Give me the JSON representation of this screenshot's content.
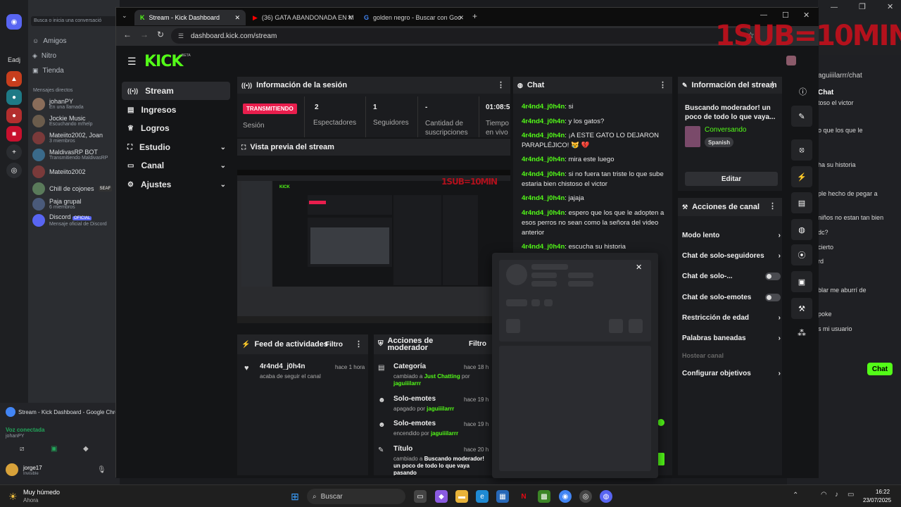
{
  "overlay_text": "1SUB=10MIN",
  "discord": {
    "search_placeholder": "Busca o inicia una conversació",
    "nav": [
      "Amigos",
      "Nitro",
      "Tienda"
    ],
    "dm_header": "Mensajes directos",
    "server_label": "Eadj",
    "dms": [
      {
        "name": "johanPY",
        "sub": "En una llamada"
      },
      {
        "name": "Jockie Music",
        "sub": "Escuchando m!help"
      },
      {
        "name": "Mateiito2002, Joan",
        "sub": "3 miembros"
      },
      {
        "name": "MaldivasRP BOT",
        "sub": "Transmitiendo MaldivasRP"
      },
      {
        "name": "Mateiito2002",
        "sub": ""
      },
      {
        "name": "Chill de cojones",
        "sub": "",
        "badge": "SEAF"
      },
      {
        "name": "Paja grupal",
        "sub": "6 miembros"
      },
      {
        "name": "Discord",
        "sub": "Mensaje oficial de Discord",
        "badge": "OFICIAL"
      }
    ],
    "stream_card": "Stream - Kick Dashboard - Google Chrome",
    "voice": "Voz conectada",
    "voice_user": "johanPY",
    "user": "jorge17",
    "user_status": "Invisible"
  },
  "chrome": {
    "tabs": [
      {
        "title": "Stream - Kick Dashboard",
        "active": true
      },
      {
        "title": "(36) GATA ABANDONADA EN M",
        "active": false
      },
      {
        "title": "golden negro - Buscar con Goo",
        "active": false
      }
    ],
    "url": "dashboard.kick.com/stream"
  },
  "kick": {
    "logo": "KICK",
    "beta": "BETA",
    "sidebar": [
      {
        "label": "Stream",
        "icon": "broadcast-icon",
        "active": true
      },
      {
        "label": "Ingresos",
        "icon": "wallet-icon"
      },
      {
        "label": "Logros",
        "icon": "trophy-icon"
      },
      {
        "label": "Estudio",
        "icon": "studio-icon",
        "expandable": true
      },
      {
        "label": "Canal",
        "icon": "channel-icon",
        "expandable": true
      },
      {
        "label": "Ajustes",
        "icon": "gear-icon",
        "expandable": true
      }
    ],
    "session": {
      "title": "Información de la sesión",
      "live_badge": "TRANSMITIENDO",
      "session_label": "Sesión",
      "stats": [
        {
          "value": "2",
          "label": "Espectadores"
        },
        {
          "value": "1",
          "label": "Seguidores"
        },
        {
          "value": "-",
          "label": "Cantidad de suscripciones"
        },
        {
          "value": "01:08:5",
          "label": "Tiempo en vivo"
        }
      ]
    },
    "preview": {
      "title": "Vista previa del stream",
      "overlay": "1SUB=10MIN"
    },
    "feed": {
      "title": "Feed de actividades",
      "filter": "Filtro",
      "items": [
        {
          "title": "4r4nd4_j0h4n",
          "sub": "acaba de seguir el canal",
          "time": "hace 1 hora"
        }
      ]
    },
    "modactions": {
      "title": "Acciones de moderador",
      "filter": "Filtro",
      "items": [
        {
          "title": "Categoría",
          "pre": "cambiado a ",
          "hl": "Just Chatting",
          "mid": " por",
          "user": "jaguiiilarrr",
          "time": "hace 18 h"
        },
        {
          "title": "Solo-emotes",
          "pre": "apagado por ",
          "hl": "",
          "mid": "",
          "user": "jaguiiilarrr",
          "time": "hace 19 h"
        },
        {
          "title": "Solo-emotes",
          "pre": "encendido por ",
          "hl": "",
          "mid": "",
          "user": "jaguiiilarrr",
          "time": "hace 19 h"
        },
        {
          "title": "Título",
          "pre": "cambiado a ",
          "hl": "Buscando moderador!",
          "mid": " un poco de todo lo que vaya pasando",
          "user": "",
          "time": "hace 20 h"
        }
      ]
    },
    "chat": {
      "title": "Chat",
      "messages": [
        {
          "user": "4r4nd4_j0h4n",
          "text": ": si"
        },
        {
          "user": "4r4nd4_j0h4n",
          "text": ": y los gatos?"
        },
        {
          "user": "4r4nd4_j0h4n",
          "text": ": ¡A ESTE GATO LO DEJARON PARAPLÉJICO! 😿 💔"
        },
        {
          "user": "4r4nd4_j0h4n",
          "text": ": mira este luego"
        },
        {
          "user": "4r4nd4_j0h4n",
          "text": ": si no fuera tan triste lo que sube estaria bien chistoso el victor"
        },
        {
          "user": "4r4nd4_j0h4n",
          "text": ": jajaja"
        },
        {
          "user": "4r4nd4_j0h4n",
          "text": ": espero que los que le adopten a esos perros no sean como la señora del video anterior"
        },
        {
          "user": "4r4nd4_j0h4n",
          "text": ": escucha su historia"
        }
      ]
    },
    "stream_info": {
      "title": "Información del stream",
      "stream_title": "Buscando moderador! un poco de todo lo que vaya...",
      "category": "Conversando",
      "language": "Spanish",
      "edit": "Editar"
    },
    "channel_actions": {
      "title": "Acciones de canal",
      "items": [
        {
          "label": "Modo lento",
          "type": "chevron"
        },
        {
          "label": "Chat de solo-seguidores",
          "type": "chevron"
        },
        {
          "label": "Chat de solo-...",
          "type": "toggle"
        },
        {
          "label": "Chat de solo-emotes",
          "type": "toggle"
        },
        {
          "label": "Restricción de edad",
          "type": "chevron"
        },
        {
          "label": "Palabras baneadas",
          "type": "chevron"
        },
        {
          "label": "Hostear canal",
          "type": "disabled"
        },
        {
          "label": "Configurar objetivos",
          "type": "chevron"
        }
      ]
    }
  },
  "bg_chat": {
    "path": "aguiiilarrr/chat",
    "title": "Chat",
    "lines": [
      "toso el victor",
      "o que los que le",
      "niños no estan tan bien",
      "ha su historia",
      "ple hecho de pegar a",
      "niños no estan tan bien",
      "dc?",
      "cierto",
      "rd",
      "blar me aburrí de",
      "poke",
      "s mi usuario"
    ],
    "button": "Chat"
  },
  "taskbar": {
    "weather": "Muy húmedo",
    "weather_sub": "Ahora",
    "search": "Buscar",
    "time": "16:22",
    "date": "23/07/2025"
  },
  "colors": {
    "kick_green": "#53fc18",
    "live_red": "#e91e4d",
    "discord_blurple": "#5865f2"
  }
}
